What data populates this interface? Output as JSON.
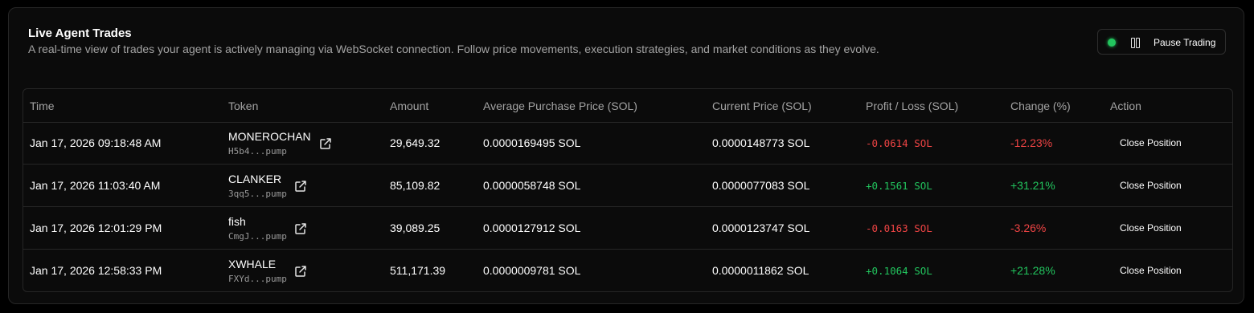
{
  "panel": {
    "title": "Live Agent Trades",
    "subtitle": "A real-time view of trades your agent is actively managing via WebSocket connection. Follow price movements, execution strategies, and market conditions as they evolve.",
    "pause_label": "Pause Trading",
    "status_color": "#22c55e"
  },
  "table": {
    "headers": [
      "Time",
      "Token",
      "Amount",
      "Average Purchase Price (SOL)",
      "Current Price (SOL)",
      "Profit / Loss (SOL)",
      "Change (%)",
      "Action"
    ],
    "rows": [
      {
        "time": "Jan 17, 2026 09:18:48 AM",
        "token": "MONEROCHAN",
        "addr": "H5b4...pump",
        "amount": "29,649.32",
        "avg_price": "0.0000169495 SOL",
        "current_price": "0.0000148773 SOL",
        "pnl": "-0.0614 SOL",
        "change": "-12.23%",
        "direction": "neg",
        "action": "Close Position"
      },
      {
        "time": "Jan 17, 2026 11:03:40 AM",
        "token": "CLANKER",
        "addr": "3qq5...pump",
        "amount": "85,109.82",
        "avg_price": "0.0000058748 SOL",
        "current_price": "0.0000077083 SOL",
        "pnl": "+0.1561 SOL",
        "change": "+31.21%",
        "direction": "pos",
        "action": "Close Position"
      },
      {
        "time": "Jan 17, 2026 12:01:29 PM",
        "token": "fish",
        "addr": "CmgJ...pump",
        "amount": "39,089.25",
        "avg_price": "0.0000127912 SOL",
        "current_price": "0.0000123747 SOL",
        "pnl": "-0.0163 SOL",
        "change": "-3.26%",
        "direction": "neg",
        "action": "Close Position"
      },
      {
        "time": "Jan 17, 2026 12:58:33 PM",
        "token": "XWHALE",
        "addr": "FXYd...pump",
        "amount": "511,171.39",
        "avg_price": "0.0000009781 SOL",
        "current_price": "0.0000011862 SOL",
        "pnl": "+0.1064 SOL",
        "change": "+21.28%",
        "direction": "pos",
        "action": "Close Position"
      }
    ]
  },
  "colors": {
    "positive": "#22c55e",
    "negative": "#ef4444"
  }
}
